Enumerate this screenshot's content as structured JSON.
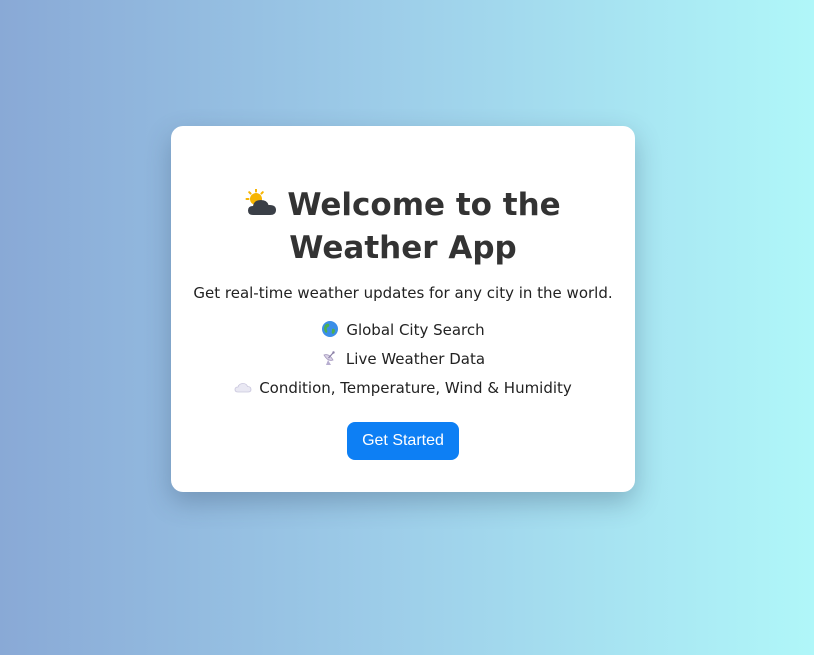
{
  "welcome": {
    "title_line1": "Welcome to the",
    "title_line2": "Weather App",
    "title_icon": "sun-behind-cloud-icon",
    "subtitle": "Get real-time weather updates for any city in the world.",
    "features": [
      {
        "icon": "globe-icon",
        "label": "Global City Search"
      },
      {
        "icon": "satellite-antenna-icon",
        "label": "Live Weather Data"
      },
      {
        "icon": "cloud-icon",
        "label": "Condition, Temperature, Wind & Humidity"
      }
    ],
    "button_label": "Get Started"
  },
  "colors": {
    "background_gradient_start": "#89a9d6",
    "background_gradient_end": "#b0f7f9",
    "card": "#ffffff",
    "button": "#0d7ff4",
    "button_text": "#ffffff",
    "title_text": "#333333"
  }
}
